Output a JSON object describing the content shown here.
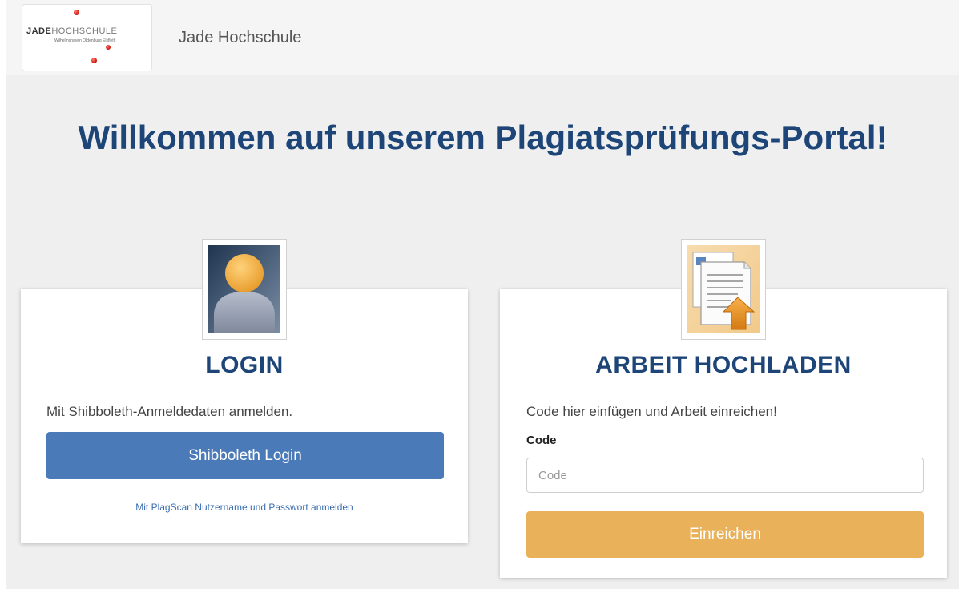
{
  "navbar": {
    "logo": {
      "word_strong": "JADE",
      "word_light": "HOCHSCHULE",
      "subline": "Wilhelmshaven Oldenburg Elsfleth"
    },
    "brand": "Jade Hochschule"
  },
  "headline": "Willkommen auf unserem Plagiatsprüfungs-Portal!",
  "login_card": {
    "icon": "user-avatar-icon",
    "title": "LOGIN",
    "description": "Mit Shibboleth-Anmeldedaten anmelden.",
    "button_label": "Shibboleth Login",
    "alt_link": "Mit PlagScan Nutzername und Passwort anmelden"
  },
  "upload_card": {
    "icon": "document-upload-icon",
    "title": "ARBEIT HOCHLADEN",
    "description": "Code hier einfügen und Arbeit einreichen!",
    "field_label": "Code",
    "field_placeholder": "Code",
    "field_value": "",
    "button_label": "Einreichen"
  },
  "colors": {
    "heading": "#1d4577",
    "primary_button": "#4a7ab8",
    "warning_button": "#e8b15a",
    "link": "#3a6db0",
    "page_bg": "#efefef"
  }
}
